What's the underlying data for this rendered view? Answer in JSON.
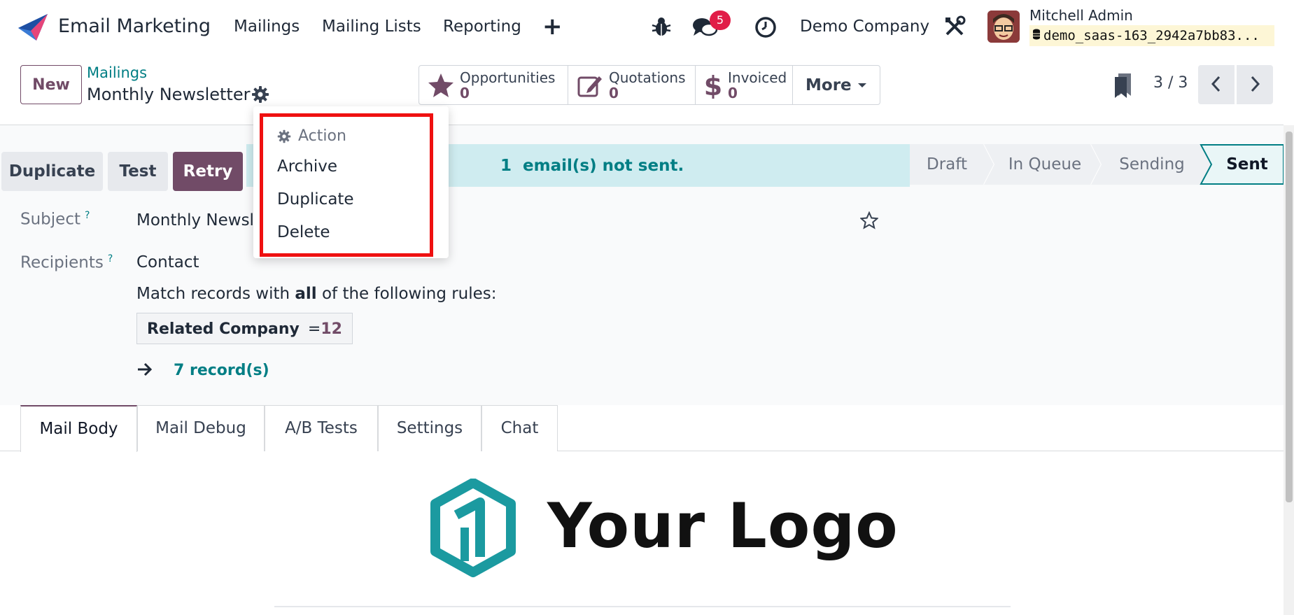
{
  "navbar": {
    "app_name": "Email Marketing",
    "menu": [
      "Mailings",
      "Mailing Lists",
      "Reporting"
    ],
    "plus_symbol": "+",
    "chat_badge": "5",
    "company": "Demo Company",
    "user_name": "Mitchell Admin",
    "database": "demo_saas-163_2942a7bb83..."
  },
  "control_panel": {
    "new_label": "New",
    "breadcrumb": "Mailings",
    "record_title": "Monthly Newsletter",
    "smart_buttons": [
      {
        "label": "Opportunities",
        "value": "0",
        "icon": "star-icon"
      },
      {
        "label": "Quotations",
        "value": "0",
        "icon": "pencil-square-icon"
      },
      {
        "label": "Invoiced",
        "value": "0",
        "icon": "dollar-icon"
      }
    ],
    "more_label": "More",
    "pager": "3 / 3"
  },
  "status_bar": {
    "buttons": [
      "Duplicate",
      "Test",
      "Retry"
    ],
    "alert_count": "1",
    "alert_text": "email(s) not sent.",
    "stages": [
      "Draft",
      "In Queue",
      "Sending",
      "Sent"
    ],
    "active_stage": "Sent"
  },
  "form": {
    "subject_label": "Subject",
    "help_mark": "?",
    "subject_value": "Monthly Newsl",
    "recipients_label": "Recipients",
    "recipients_value": "Contact",
    "rule_prefix": "Match records with",
    "rule_bold": "all",
    "rule_suffix": "of the following rules:",
    "rule_field": "Related Company",
    "rule_operator": "=",
    "rule_value": "12",
    "records_link": "7 record(s)"
  },
  "tabs": [
    "Mail Body",
    "Mail Debug",
    "A/B Tests",
    "Settings",
    "Chat"
  ],
  "active_tab": "Mail Body",
  "mail_body": {
    "logo_text": "Your Logo"
  },
  "action_menu": {
    "header": "Action",
    "items": [
      "Archive",
      "Duplicate",
      "Delete"
    ]
  },
  "colors": {
    "brand": "#714b67",
    "link": "#017e84",
    "alert_bg": "#cfecf0",
    "highlight": "#ef1010",
    "logo_teal": "#1b9aa0"
  }
}
